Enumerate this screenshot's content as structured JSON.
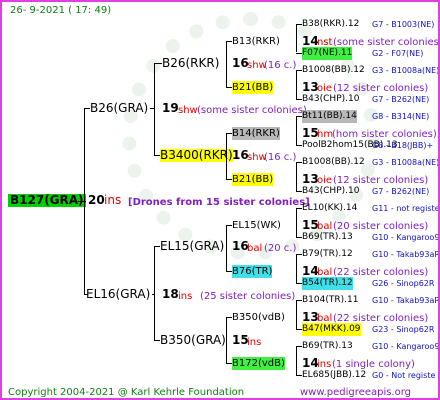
{
  "header": "26-  9-2021 (  17:  49)",
  "footer": {
    "copyright": "Copyright 2004-2021 @ Karl Kehrle Foundation",
    "site": "www.pedigreeapis.org"
  },
  "root": {
    "name": "B127(GRA)",
    "num": "20",
    "ins": "ins",
    "note": "[Drones from 15 sister colonies]"
  },
  "gen1": [
    {
      "name": "B26(GRA)",
      "num": "19",
      "ins": "shw",
      "note": "(some sister colonies)"
    },
    {
      "name": "EL16(GRA)",
      "num": "18",
      "ins": "ins",
      "note": "(25 sister colonies)"
    }
  ],
  "gen2": [
    {
      "name": "B26(RKR)",
      "num": "16",
      "ins": "shw",
      "note": "(16 c.)"
    },
    {
      "name": "B3400(RKR)",
      "num": "16",
      "ins": "shw",
      "note": "(16 c.)"
    },
    {
      "name": "EL15(GRA)",
      "num": "16",
      "ins": "bal",
      "note": "(20 c.)"
    },
    {
      "name": "B350(GRA)",
      "num": "15",
      "ins": "ins",
      "note": ""
    }
  ],
  "gen3": [
    {
      "name": "B13(RKR)",
      "num": "14",
      "ins": "nst",
      "note": "(some sister colonies)"
    },
    {
      "name": "B21(BB)",
      "num": "13",
      "ins": "oie",
      "note": "(12 sister colonies)"
    },
    {
      "name": "B14(RKR)",
      "num": "15",
      "ins": "hm",
      "note": "(hom sister colonies)"
    },
    {
      "name": "B21(BB)",
      "num": "13",
      "ins": "oie",
      "note": "(12 sister colonies)"
    },
    {
      "name": "EL15(WK)",
      "num": "15",
      "ins": "bal",
      "note": "(20 sister colonies)"
    },
    {
      "name": "B76(TR)",
      "num": "14",
      "ins": "bal",
      "note": "(22 sister colonies)"
    },
    {
      "name": "B350(vdB)",
      "num": "13",
      "ins": "bal",
      "note": "(22 sister colonies)"
    },
    {
      "name": "B172(vdB)",
      "num": "14",
      "ins": "ins",
      "note": "(1 single colony)"
    }
  ],
  "gen4": [
    {
      "name": "B38(RKR).12",
      "ref": "G7 - B1003(NE)"
    },
    {
      "name": "F07(NE).11",
      "ref": "G2 - F07(NE)"
    },
    {
      "name": "B1008(BB).12",
      "ref": "G3 - B1008a(NE)"
    },
    {
      "name": "B43(CHP).10",
      "ref": "G7 - B262(NE)"
    },
    {
      "name": "Bt11(BB).14",
      "ref": "G8 - B314(NE)"
    },
    {
      "name": "PoolB2hom15(BB).13",
      "ref": "G8 - B18(JBB)+"
    },
    {
      "name": "B1008(BB).12",
      "ref": "G3 - B1008a(NE)"
    },
    {
      "name": "B43(CHP).10",
      "ref": "G7 - B262(NE)"
    },
    {
      "name": "EL10(KK).14",
      "ref": "G11 - not registe"
    },
    {
      "name": "B69(TR).13",
      "ref": "G10 - Kangaroo98R"
    },
    {
      "name": "B79(TR).12",
      "ref": "G10 - Takab93aR"
    },
    {
      "name": "B54(TR).12",
      "ref": "G26 - Sinop62R"
    },
    {
      "name": "B104(TR).11",
      "ref": "G10 - Takab93aR"
    },
    {
      "name": "B47(MKK).09",
      "ref": "G23 - Sinop62R"
    },
    {
      "name": "B69(TR).13",
      "ref": "G10 - Kangaroo98R"
    },
    {
      "name": "EL685(JBB).12",
      "ref": "G0 - Not registe"
    }
  ]
}
